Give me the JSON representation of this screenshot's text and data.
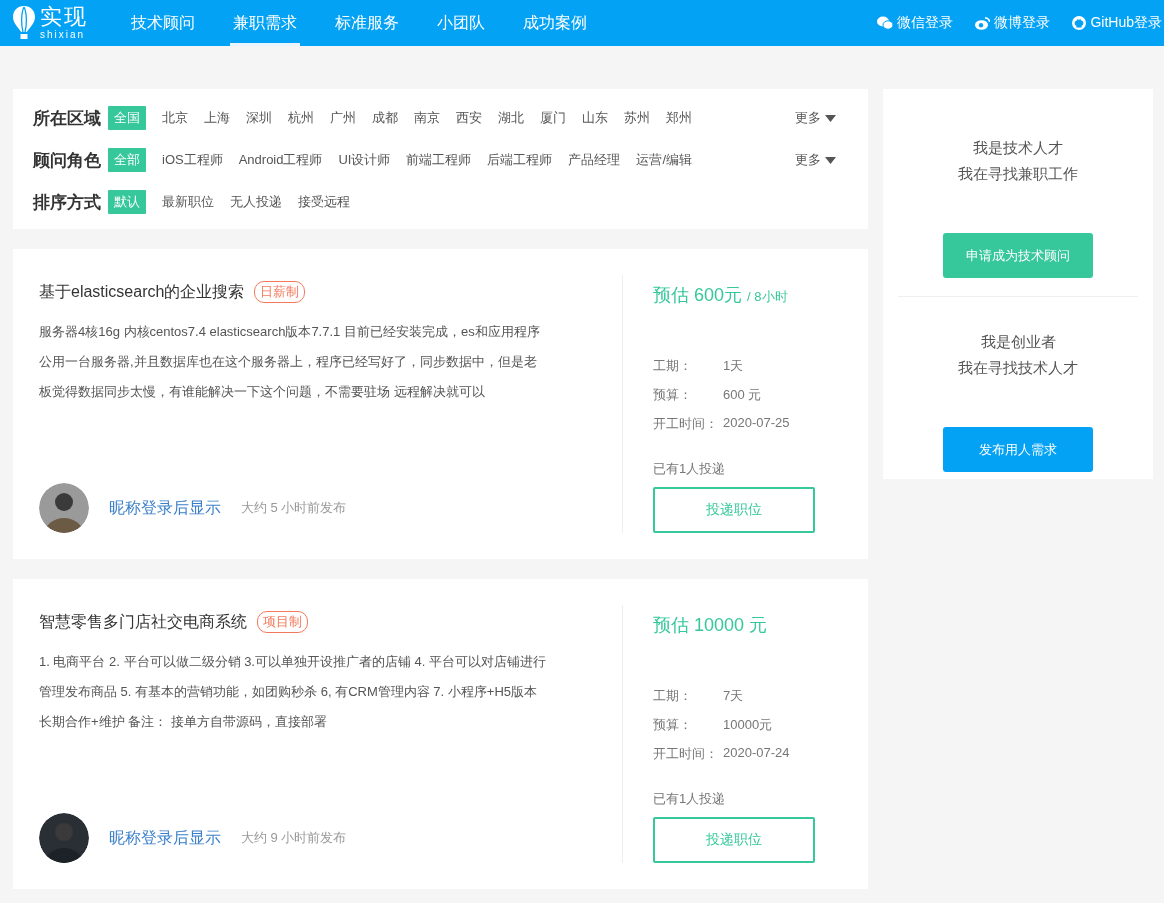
{
  "nav": {
    "logo": {
      "title": "实现",
      "subtitle": "shixian"
    },
    "items": [
      {
        "label": "技术顾问",
        "selected": false
      },
      {
        "label": "兼职需求",
        "selected": true
      },
      {
        "label": "标准服务",
        "selected": false
      },
      {
        "label": "小团队",
        "selected": false
      },
      {
        "label": "成功案例",
        "selected": false
      }
    ],
    "logins": [
      {
        "kind": "wechat",
        "label": "微信登录"
      },
      {
        "kind": "weibo",
        "label": "微博登录"
      },
      {
        "kind": "github",
        "label": "GitHub登录"
      }
    ]
  },
  "filters": [
    {
      "label": "所在区域",
      "more": "更多",
      "options": [
        {
          "label": "全国",
          "selected": true
        },
        {
          "label": "北京",
          "selected": false
        },
        {
          "label": "上海",
          "selected": false
        },
        {
          "label": "深圳",
          "selected": false
        },
        {
          "label": "杭州",
          "selected": false
        },
        {
          "label": "广州",
          "selected": false
        },
        {
          "label": "成都",
          "selected": false
        },
        {
          "label": "南京",
          "selected": false
        },
        {
          "label": "西安",
          "selected": false
        },
        {
          "label": "湖北",
          "selected": false
        },
        {
          "label": "厦门",
          "selected": false
        },
        {
          "label": "山东",
          "selected": false
        },
        {
          "label": "苏州",
          "selected": false
        },
        {
          "label": "郑州",
          "selected": false
        }
      ]
    },
    {
      "label": "顾问角色",
      "more": "更多",
      "options": [
        {
          "label": "全部",
          "selected": true
        },
        {
          "label": "iOS工程师",
          "selected": false
        },
        {
          "label": "Android工程师",
          "selected": false
        },
        {
          "label": "UI设计师",
          "selected": false
        },
        {
          "label": "前端工程师",
          "selected": false
        },
        {
          "label": "后端工程师",
          "selected": false
        },
        {
          "label": "产品经理",
          "selected": false
        },
        {
          "label": "运营/编辑",
          "selected": false
        }
      ]
    },
    {
      "label": "排序方式",
      "options": [
        {
          "label": "默认",
          "selected": true
        },
        {
          "label": "最新职位",
          "selected": false
        },
        {
          "label": "无人投递",
          "selected": false
        },
        {
          "label": "接受远程",
          "selected": false
        }
      ]
    }
  ],
  "jobs": [
    {
      "title": "基于elasticsearch的企业搜索",
      "tag": "日薪制",
      "description": [
        "服务器4核16g 内核centos7.4 elasticsearch版本7.7.1 目前已经安装完成，es和应用程序",
        "公用一台服务器,并且数据库也在这个服务器上，程序已经写好了，同步数据中，但是老",
        "板觉得数据同步太慢，有谁能解决一下这个问题，不需要驻场 远程解决就可以"
      ],
      "author": "昵称登录后显示",
      "posted": "大约 5 小时前发布",
      "price": "预估 600元",
      "price_unit": "/ 8小时",
      "details": [
        {
          "label": "工期：",
          "value": "1天"
        },
        {
          "label": "预算：",
          "value": "600 元"
        },
        {
          "label": "开工时间：",
          "value": "2020-07-25"
        }
      ],
      "applicants": "已有1人投递",
      "apply": "投递职位"
    },
    {
      "title": "智慧零售多门店社交电商系统",
      "tag": "项目制",
      "description": [
        "1. 电商平台 2. 平台可以做二级分销 3.可以单独开设推广者的店铺 4. 平台可以对店铺进行",
        "管理发布商品 5. 有基本的营销功能，如团购秒杀 6, 有CRM管理内容 7. 小程序+H5版本",
        "长期合作+维护 备注： 接单方自带源码，直接部署"
      ],
      "author": "昵称登录后显示",
      "posted": "大约 9 小时前发布",
      "price": "预估 10000 元",
      "details": [
        {
          "label": "工期：",
          "value": "7天"
        },
        {
          "label": "预算：",
          "value": "10000元"
        },
        {
          "label": "开工时间：",
          "value": "2020-07-24"
        }
      ],
      "applicants": "已有1人投递",
      "apply": "投递职位"
    }
  ],
  "sidebar": [
    {
      "lines": [
        "我是技术人才",
        "我在寻找兼职工作"
      ],
      "button": "申请成为技术顾问",
      "kind": "talent"
    },
    {
      "lines": [
        "我是创业者",
        "我在寻找技术人才"
      ],
      "button": "发布用人需求",
      "kind": "employer"
    }
  ]
}
